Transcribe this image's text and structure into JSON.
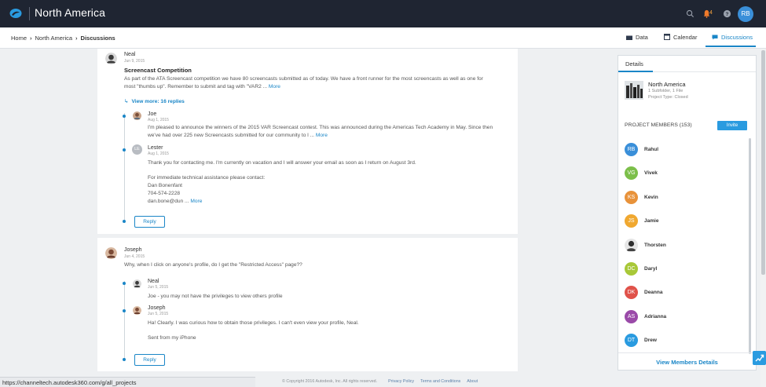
{
  "app": {
    "title": "North America",
    "notification_count": "4",
    "user_initials": "RB"
  },
  "breadcrumb": {
    "home": "Home",
    "parent": "North America",
    "current": "Discussions"
  },
  "view_tabs": [
    {
      "label": "Data"
    },
    {
      "label": "Calendar"
    },
    {
      "label": "Discussions"
    }
  ],
  "discussions": [
    {
      "author": "Neal",
      "date": "Jun 9, 2015",
      "title": "Screencast Competition",
      "body_line1": "As part of the ATA Screencast competition we have 80 screencasts submitted as of today. We have a front runner for the most screencasts as well as one for",
      "body_line2": "most \"thumbs up\". Remember to submit and tag with \"VAR2 ...",
      "more": "More",
      "view_more": "View more: 16 replies",
      "replies": [
        {
          "author": "Joe",
          "date": "Aug 1, 2015",
          "line1": "I'm pleased to announce the winners of the 2015 VAR Screencast contest. This was announced during the Americas Tech Academy in May. Since then",
          "line2": "we've had over 225 new Screencasts submitted for our community to l ...",
          "more": "More"
        },
        {
          "author": "Lester",
          "initials": "LE",
          "date": "Aug 1, 2015",
          "line1": "Thank you for contacting me. I'm currently on vacation and I will answer your email as soon as I return on August 3rd.",
          "line2": "For immediate technical assistance please contact:",
          "line3": "Dan Bonenfant",
          "line4": "704-574-2228",
          "line5": "dan.bone@dun ...",
          "more": "More"
        }
      ],
      "reply_label": "Reply"
    },
    {
      "author": "Joseph",
      "date": "Jun 4, 2015",
      "body_line1": "Why, when I click on anyone's profile, do I get the \"Restricted Access\" page??",
      "replies": [
        {
          "author": "Neal",
          "date": "Jun 5, 2015",
          "line1": "Joe - you may not have the privileges to view others profile"
        },
        {
          "author": "Joseph",
          "date": "Jun 5, 2015",
          "line1": "Ha! Clearly. I was curious how to obtain those privileges. I can't even view your profile, Neal.",
          "line2": "Sent from my iPhone"
        }
      ],
      "reply_label": "Reply"
    }
  ],
  "details_panel": {
    "tab_label": "Details",
    "project_name": "North America",
    "project_contents": "1 Subfolder, 1 File",
    "project_type": "Project Type: Closed",
    "members_heading": "PROJECT MEMBERS (153)",
    "invite_label": "Invite",
    "members": [
      {
        "initials": "RB",
        "name": "Rahul",
        "color": "#3a8fd9"
      },
      {
        "initials": "VG",
        "name": "Vivek",
        "color": "#7cbf4a"
      },
      {
        "initials": "KS",
        "name": "Kevin",
        "color": "#e8923a"
      },
      {
        "initials": "JS",
        "name": "Jamie",
        "color": "#f0a830"
      },
      {
        "initials": "",
        "name": "Thorsten",
        "color": "#e6e6e6"
      },
      {
        "initials": "DC",
        "name": "Daryl",
        "color": "#a8c838"
      },
      {
        "initials": "DK",
        "name": "Deanna",
        "color": "#e0524a"
      },
      {
        "initials": "AS",
        "name": "Adrianna",
        "color": "#9a4aa8"
      },
      {
        "initials": "DT",
        "name": "Drew",
        "color": "#2a9be0"
      }
    ],
    "view_members_label": "View Members Details"
  },
  "footer": {
    "copyright": "© Copyright 2016 Autodesk, Inc. All rights reserved.",
    "privacy": "Privacy Policy",
    "terms": "Terms and Conditions",
    "about": "About"
  },
  "status_url": "https://channeltech.autodesk360.com/g/all_projects",
  "colors": {
    "accent": "#1a86c7",
    "topbar": "#1f2532"
  }
}
